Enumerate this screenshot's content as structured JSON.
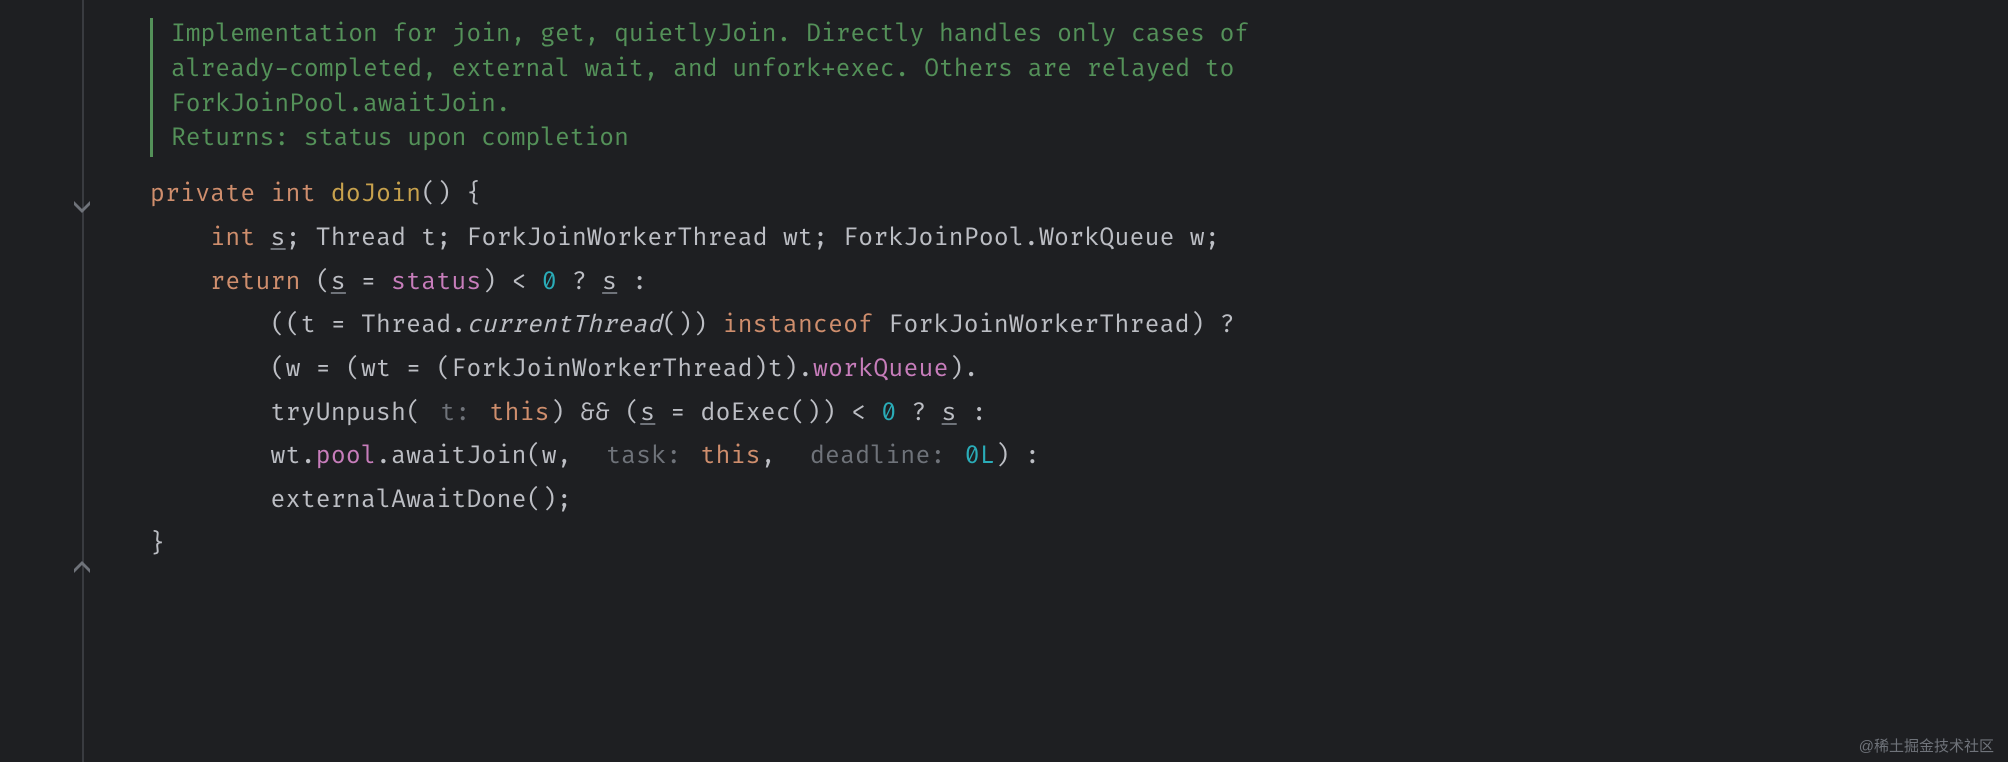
{
  "doc": {
    "l1": "Implementation for join, get, quietlyJoin. Directly handles only cases of",
    "l2": "already-completed, external wait, and unfork+exec. Others are relayed to",
    "l3": "ForkJoinPool.awaitJoin.",
    "returns_label": "Returns:",
    "returns_text": " status upon completion"
  },
  "code": {
    "kw_private": "private",
    "kw_int": "int",
    "decl_name": "doJoin",
    "decl_tail": "() {",
    "var_decl_prefix": "    ",
    "var_int": "int",
    "var_s": "s",
    "var_sep1": "; Thread t; ForkJoinWorkerThread wt; ForkJoinPool.WorkQueue w;",
    "ret_indent": "    ",
    "kw_return": "return",
    "ret_open": " (",
    "ret_s1": "s",
    "ret_eq": " = ",
    "status": "status",
    "ret_cmp": ") < ",
    "zero": "0",
    "ret_q": " ? ",
    "ret_s2": "s",
    "ret_colon": " :",
    "l2_indent": "        ((t = Thread.",
    "currentThread": "currentThread",
    "l2_paren": "()) ",
    "instanceof": "instanceof",
    "l2_tail": " ForkJoinWorkerThread) ?",
    "l3_indent": "        (w = (wt = (ForkJoinWorkerThread)t).",
    "workQueue": "workQueue",
    "l3_tail": ").",
    "l4_indent": "        tryUnpush(",
    "hint_t": " t: ",
    "this1": "this",
    "l4_mid": ") && (",
    "l4_s": "s",
    "l4_eq": " = doExec()) < ",
    "l4_zero": "0",
    "l4_q": " ? ",
    "l4_s2": "s",
    "l4_colon": " :",
    "l5_indent": "        wt.",
    "pool": "pool",
    "l5_dot": ".awaitJoin(w, ",
    "hint_task": " task: ",
    "this2": "this",
    "l5_comma": ", ",
    "hint_deadline": " deadline: ",
    "zeroL": "0L",
    "l5_tail": ") :",
    "l6": "        externalAwaitDone();",
    "close": "}"
  },
  "watermark": "@稀土掘金技术社区"
}
